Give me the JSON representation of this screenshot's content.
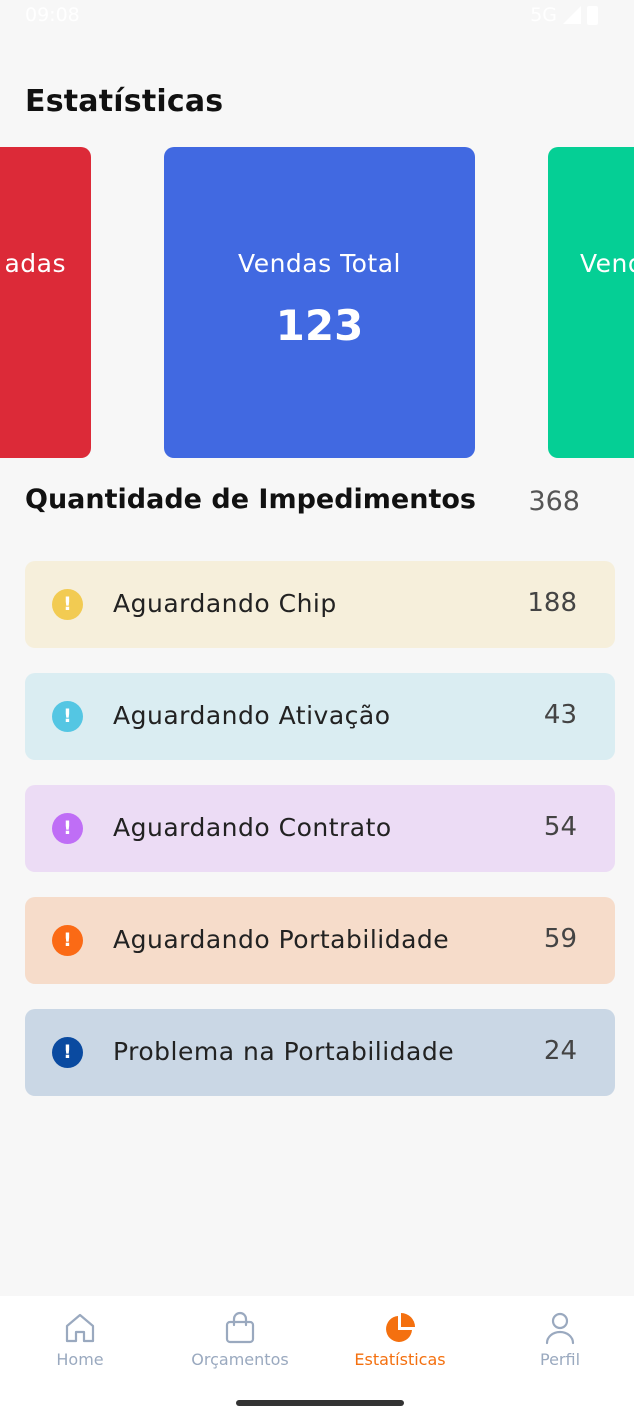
{
  "status_bar": {
    "time": "09:08",
    "network": "5G"
  },
  "page_title": "Estatísticas",
  "cards": [
    {
      "label": "adas",
      "value": "",
      "color": "#dc2a38"
    },
    {
      "label": "Vendas Total",
      "value": "123",
      "color": "#4169e1"
    },
    {
      "label": "Vend",
      "value": "",
      "color": "#05cf95"
    }
  ],
  "impediments": {
    "title": "Quantidade de Impedimentos",
    "total": "368",
    "items": [
      {
        "label": "Aguardando Chip",
        "count": "188",
        "icon": "alert-circle-icon",
        "icon_color": "#f2cb52",
        "bg": "#f6efdb"
      },
      {
        "label": "Aguardando Ativação",
        "count": "43",
        "icon": "alert-circle-icon",
        "icon_color": "#54c6e3",
        "bg": "#daedf2"
      },
      {
        "label": "Aguardando Contrato",
        "count": "54",
        "icon": "alert-circle-icon",
        "icon_color": "#bf6ef6",
        "bg": "#ecdcf5"
      },
      {
        "label": "Aguardando Portabilidade",
        "count": "59",
        "icon": "alert-circle-icon",
        "icon_color": "#fb6a15",
        "bg": "#f6dcca"
      },
      {
        "label": "Problema na Portabilidade",
        "count": "24",
        "icon": "alert-circle-icon",
        "icon_color": "#0a4aa0",
        "bg": "#cad7e5"
      }
    ]
  },
  "nav": {
    "items": [
      {
        "label": "Home",
        "icon": "home-icon",
        "active": false
      },
      {
        "label": "Orçamentos",
        "icon": "shopping-bag-icon",
        "active": false
      },
      {
        "label": "Estatísticas",
        "icon": "pie-chart-icon",
        "active": true
      },
      {
        "label": "Perfil",
        "icon": "user-icon",
        "active": false
      }
    ],
    "active_color": "#f4700f",
    "inactive_color": "#9aa9bf"
  }
}
